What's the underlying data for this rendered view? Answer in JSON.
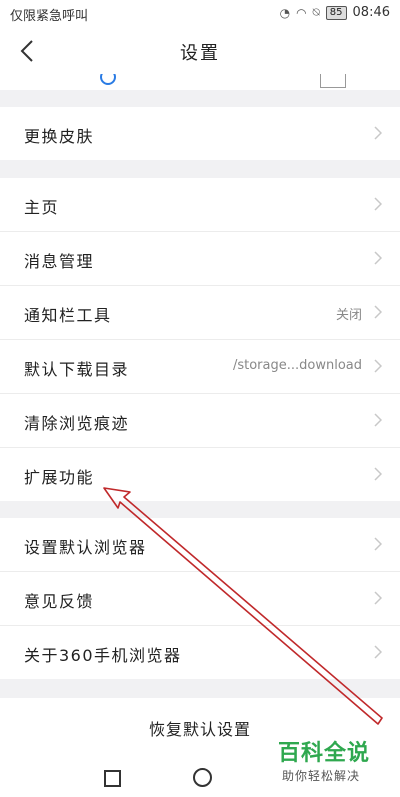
{
  "status_bar": {
    "carrier": "仅限紧急呼叫",
    "battery": "85",
    "time": "08:46"
  },
  "header": {
    "title": "设置"
  },
  "groups": [
    {
      "items": [
        {
          "label": "更换皮肤",
          "value": ""
        }
      ]
    },
    {
      "items": [
        {
          "label": "主页",
          "value": ""
        },
        {
          "label": "消息管理",
          "value": ""
        },
        {
          "label": "通知栏工具",
          "value": "关闭"
        },
        {
          "label": "默认下载目录",
          "value": "/storage...download"
        },
        {
          "label": "清除浏览痕迹",
          "value": ""
        },
        {
          "label": "扩展功能",
          "value": ""
        }
      ]
    },
    {
      "items": [
        {
          "label": "设置默认浏览器",
          "value": ""
        },
        {
          "label": "意见反馈",
          "value": ""
        },
        {
          "label": "关于360手机浏览器",
          "value": ""
        }
      ]
    }
  ],
  "restore_label": "恢复默认设置",
  "watermark": {
    "title": "百科全说",
    "subtitle": "助你轻松解决"
  },
  "colors": {
    "arrow": "#c0292b",
    "watermark_green": "#2fa84f"
  }
}
